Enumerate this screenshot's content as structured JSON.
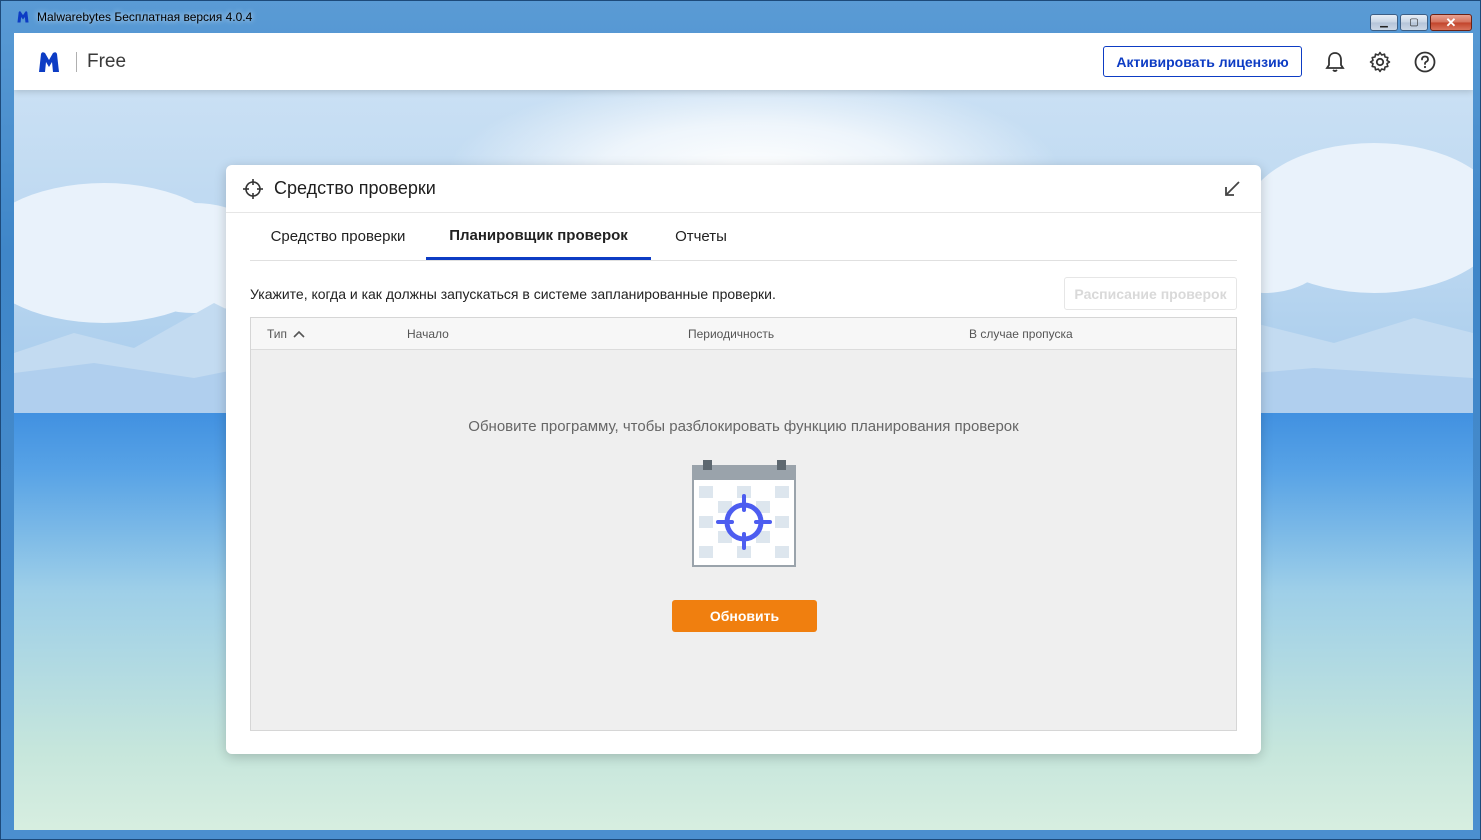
{
  "window": {
    "title": "Malwarebytes Бесплатная версия  4.0.4",
    "min_glyph": "▁",
    "max_glyph": "▢",
    "close_glyph": "✕"
  },
  "appbar": {
    "product": "Free",
    "activate_label": "Активировать лицензию",
    "icons": [
      "bell-icon",
      "gear-icon",
      "help-icon"
    ]
  },
  "card": {
    "title": "Средство проверки",
    "tabs": [
      {
        "label": "Средство проверки",
        "active": false
      },
      {
        "label": "Планировщик проверок",
        "active": true
      },
      {
        "label": "Отчеты",
        "active": false
      }
    ],
    "description": "Укажите, когда и как должны запускаться в системе запланированные проверки.",
    "schedule_button": "Расписание проверок",
    "table": {
      "columns": [
        "Тип",
        "Начало",
        "Периодичность",
        "В случае пропуска"
      ],
      "empty_message": "Обновите программу, чтобы разблокировать функцию планирования проверок",
      "update_button": "Обновить"
    }
  },
  "colors": {
    "accent_blue": "#0d3cc4",
    "update_orange": "#f07f0f"
  }
}
